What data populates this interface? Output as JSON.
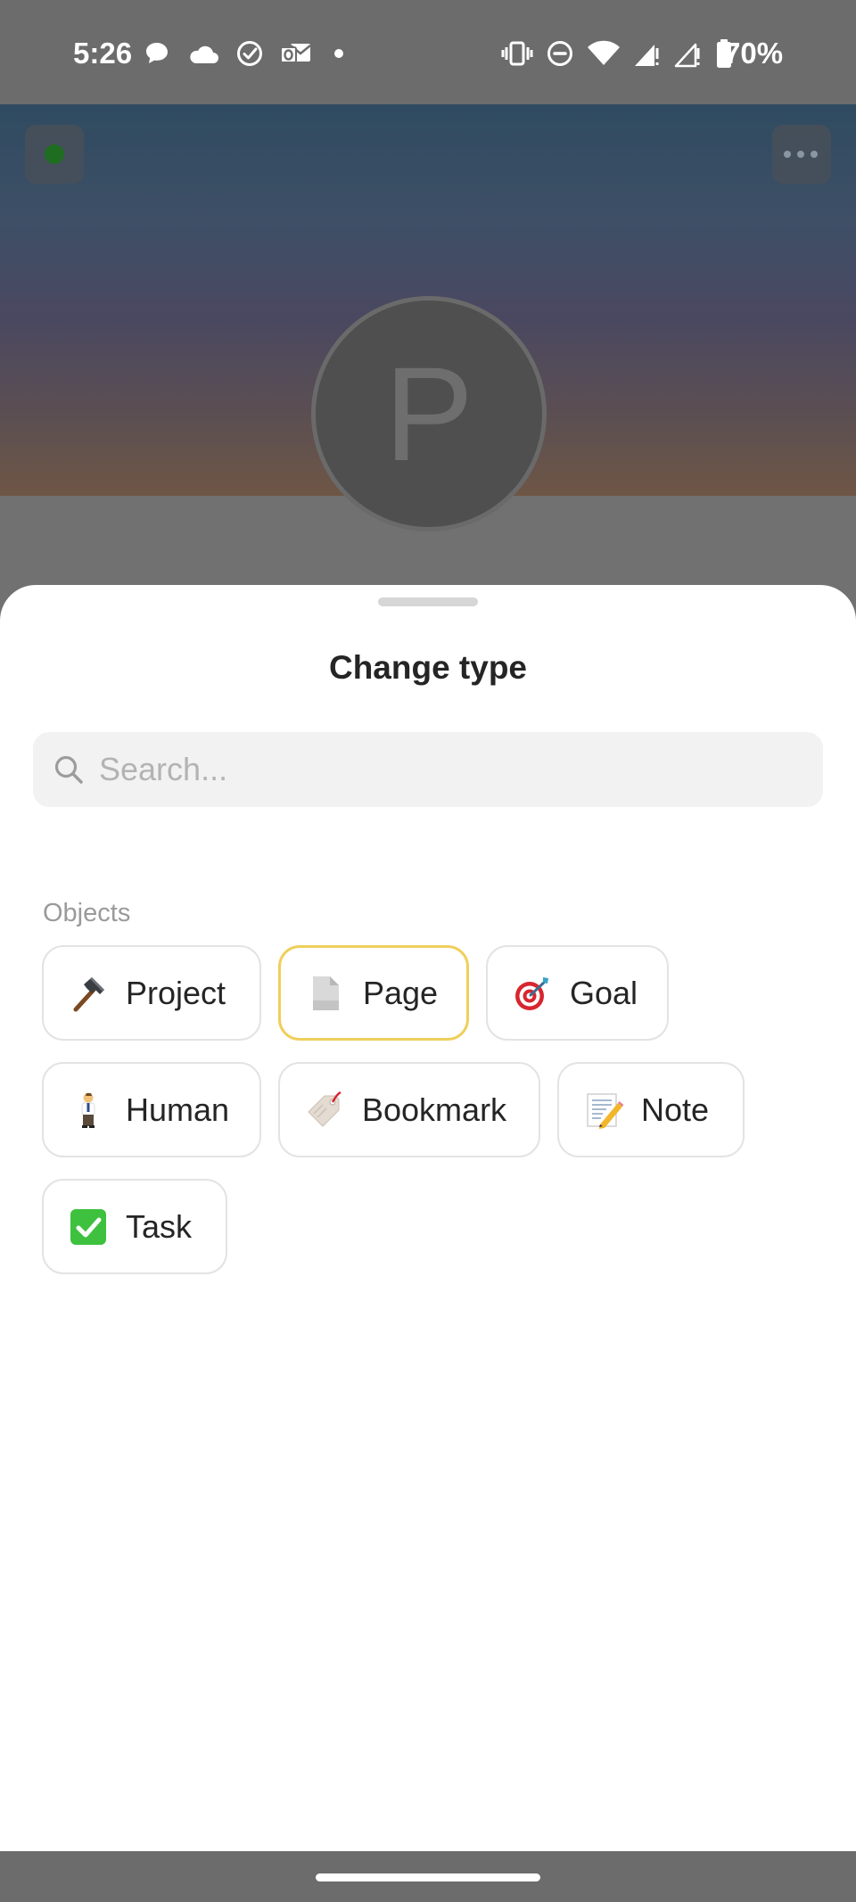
{
  "status_bar": {
    "time": "5:26",
    "battery_percent": "70%",
    "left_icons": [
      "chat-bubble-icon",
      "cloud-icon",
      "check-circle-icon",
      "outlook-icon",
      "dot-icon"
    ],
    "right_icons": [
      "vibrate-icon",
      "do-not-disturb-icon",
      "wifi-icon",
      "signal-icon",
      "signal-icon",
      "battery-icon"
    ]
  },
  "background_page": {
    "avatar_letter": "P"
  },
  "sheet": {
    "title": "Change type",
    "search": {
      "placeholder": "Search...",
      "value": ""
    },
    "section_label": "Objects",
    "selected_type": "Page",
    "types": [
      {
        "label": "Project",
        "icon": "hammer-icon"
      },
      {
        "label": "Page",
        "icon": "page-icon"
      },
      {
        "label": "Goal",
        "icon": "target-icon"
      },
      {
        "label": "Human",
        "icon": "person-icon"
      },
      {
        "label": "Bookmark",
        "icon": "bookmark-tag-icon"
      },
      {
        "label": "Note",
        "icon": "memo-icon"
      },
      {
        "label": "Task",
        "icon": "checkbox-icon"
      }
    ]
  },
  "colors": {
    "selected_border": "#efcf5b",
    "chip_border": "#e3e3e3",
    "task_green": "#3ec13e",
    "scrim": "#6c6c6c"
  }
}
